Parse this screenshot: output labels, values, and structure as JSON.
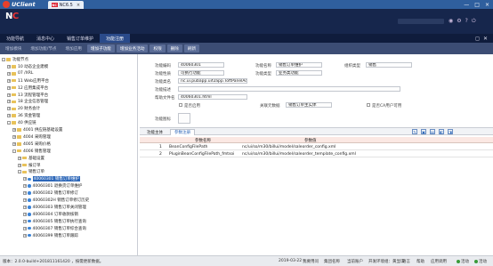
{
  "app": {
    "brand": "UClient",
    "tab_label": "NC6.5",
    "nc_mini": "NC",
    "tab_close": "×",
    "win_min": "—",
    "win_max": "□",
    "win_close": "×"
  },
  "header": {
    "logo_main": "N",
    "logo_c": "C"
  },
  "menu": {
    "items": [
      "功能导航",
      "消息中心",
      "销售订单维护",
      "功能注册"
    ],
    "active": 3,
    "right_icons": [
      "◻",
      "✕"
    ]
  },
  "toolbar": {
    "buttons": [
      "增加",
      "修改",
      "删除",
      "刷新",
      "复制",
      "粘贴",
      "查询",
      "预置"
    ],
    "labels": [
      "增加模块",
      "增加功能/节点",
      "增加应用",
      "增加子功能",
      "增加业务活动",
      "权限",
      "删除",
      "刷新"
    ],
    "active": [
      3,
      4,
      5,
      6,
      7
    ]
  },
  "tree": {
    "rows": [
      {
        "depth": 0,
        "exp": "-",
        "icon": "folder",
        "label": "功能节点"
      },
      {
        "depth": 1,
        "exp": "+",
        "icon": "folder",
        "label": "10 动态企业建模"
      },
      {
        "depth": 1,
        "exp": "+",
        "icon": "folder",
        "label": "07 /XRL"
      },
      {
        "depth": 1,
        "exp": "+",
        "icon": "folder",
        "label": "11 Web应用平台"
      },
      {
        "depth": 1,
        "exp": "+",
        "icon": "folder",
        "label": "12 应用集成平台"
      },
      {
        "depth": 1,
        "exp": "+",
        "icon": "folder",
        "label": "13 流程管理平台"
      },
      {
        "depth": 1,
        "exp": "+",
        "icon": "folder",
        "label": "18 企业信息管理"
      },
      {
        "depth": 1,
        "exp": "+",
        "icon": "folder",
        "label": "20 财务会计"
      },
      {
        "depth": 1,
        "exp": "+",
        "icon": "folder",
        "label": "36 资金管理"
      },
      {
        "depth": 1,
        "exp": "-",
        "icon": "folder",
        "label": "40 供应链"
      },
      {
        "depth": 2,
        "exp": "+",
        "icon": "folder",
        "label": "4001 供应链基础设置"
      },
      {
        "depth": 2,
        "exp": "+",
        "icon": "folder",
        "label": "4004 采购管理"
      },
      {
        "depth": 2,
        "exp": "+",
        "icon": "folder",
        "label": "4005 采购价格"
      },
      {
        "depth": 2,
        "exp": "-",
        "icon": "folder",
        "label": "4006 销售管理"
      },
      {
        "depth": 3,
        "exp": "+",
        "icon": "folder",
        "label": "基础设置"
      },
      {
        "depth": 3,
        "exp": "+",
        "icon": "folder",
        "label": "报订单"
      },
      {
        "depth": 3,
        "exp": "-",
        "icon": "folder",
        "label": "销售订单"
      },
      {
        "depth": 4,
        "exp": "+",
        "icon": "dot",
        "label": "40060301 销售订单维护",
        "selected": true
      },
      {
        "depth": 4,
        "exp": "+",
        "icon": "dot",
        "label": "40060301 退换货订单维护"
      },
      {
        "depth": 4,
        "exp": "+",
        "icon": "dot",
        "label": "40060302 销售订单修订"
      },
      {
        "depth": 4,
        "exp": "+",
        "icon": "dot",
        "label": "40060302H 销售订单修订历史"
      },
      {
        "depth": 4,
        "exp": "+",
        "icon": "dot",
        "label": "40060303 销售订单关闭管理"
      },
      {
        "depth": 4,
        "exp": "+",
        "icon": "dot",
        "label": "40060304 订单收款核销"
      },
      {
        "depth": 4,
        "exp": "+",
        "icon": "dot",
        "label": "40060305 销售订单执行查询"
      },
      {
        "depth": 4,
        "exp": "+",
        "icon": "dot",
        "label": "40060307 销售订单综合查询"
      },
      {
        "depth": 4,
        "exp": "+",
        "icon": "dot",
        "label": "40060399 销售订单跟踪"
      }
    ]
  },
  "form": {
    "code_label": "功能编码",
    "code": "40060301",
    "name_label": "功能名称",
    "name": "销售订单维护",
    "org_label": "组织类型",
    "org": "销售",
    "prop_label": "功能性质",
    "prop": "可执行功能",
    "type_label": "功能类型",
    "type": "业务类功能",
    "class_label": "功能类名",
    "class": "nc.ui.pubapp.uif2app.ToftPanelAdaptorEx",
    "desc_label": "功能描述",
    "desc": "",
    "help_label": "帮助文件名",
    "help": "40060301.html",
    "chk1_label": "是否启用",
    "rel_label": "关联元数据",
    "rel": "销售订单主实体",
    "chk2_label": "是否CA用户可用",
    "image_label": "功能图标",
    "image": ""
  },
  "subtabs": {
    "items": [
      "功能主体",
      "参数注册"
    ],
    "active": 1,
    "icons": [
      "✎",
      "▣",
      "▤",
      "◧",
      "◨"
    ]
  },
  "grid": {
    "headers": [
      "参数名称",
      "参数值"
    ],
    "rows": [
      {
        "no": "1",
        "name": "BeanConfigFilePath",
        "value": "nc/ui/so/m30/billui/model/saleorder_config.xml"
      },
      {
        "no": "2",
        "name": "PluginBeanConfigFilePath_fmtsoi",
        "value": "nc/ui/so/m30/billui/model/saleorder_template_config.xml"
      }
    ]
  },
  "status": {
    "version": "版本：2.0.0-build+201811161420 ，按需更新数据。",
    "date": "2019-03-22",
    "msg": "我要用问",
    "org": "集团名称",
    "user": "当前账户",
    "env": "开发环境组：黄显琪",
    "lang": "语言",
    "help": "帮助",
    "lock": "应用调用",
    "dots": [
      "活动",
      "活动"
    ]
  },
  "colors": {
    "header": "#16264c",
    "menu_active": "#2a4a8a",
    "toolbar": "#3c4d74",
    "selected": "#2d67b8",
    "grid_head": "#fbe8e3"
  }
}
